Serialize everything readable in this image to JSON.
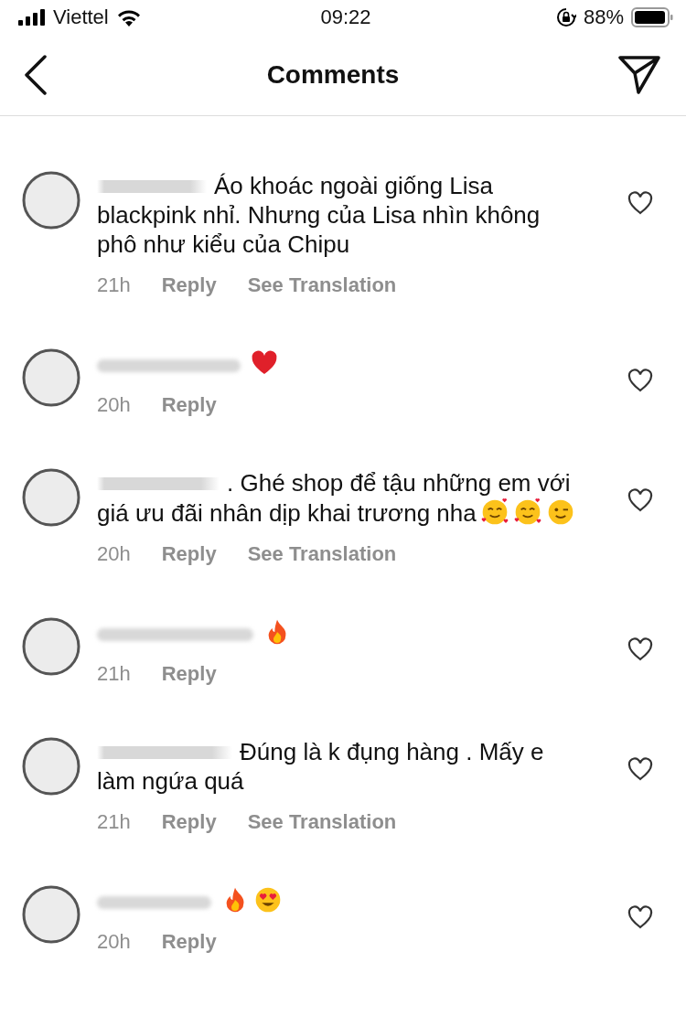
{
  "status_bar": {
    "carrier": "Viettel",
    "time": "09:22",
    "battery": "88%"
  },
  "header": {
    "title": "Comments"
  },
  "comments": [
    {
      "text": "Áo khoác ngoài giống Lisa blackpink nhỉ. Nhưng của Lisa nhìn không phô như kiểu của Chipu",
      "time": "21h",
      "actions": [
        "Reply",
        "See Translation"
      ]
    },
    {
      "emoji": [
        {
          "kind": "heart"
        }
      ],
      "time": "20h",
      "actions": [
        "Reply"
      ]
    },
    {
      "text": ". Ghé shop để tậu những em với giá ưu đãi nhân dịp khai trương nha",
      "emoji": [
        {
          "kind": "hearts-face"
        },
        {
          "kind": "hearts-face"
        },
        {
          "kind": "wink"
        }
      ],
      "time": "20h",
      "actions": [
        "Reply",
        "See Translation"
      ]
    },
    {
      "emoji": [
        {
          "kind": "fire"
        }
      ],
      "time": "21h",
      "actions": [
        "Reply"
      ]
    },
    {
      "text": "Đúng là k đụng hàng . Mấy e làm ngứa quá",
      "time": "21h",
      "actions": [
        "Reply",
        "See Translation"
      ]
    },
    {
      "emoji": [
        {
          "kind": "fire"
        },
        {
          "kind": "heart-eyes"
        }
      ],
      "time": "20h",
      "actions": [
        "Reply"
      ]
    }
  ]
}
